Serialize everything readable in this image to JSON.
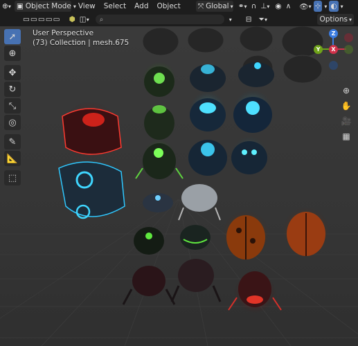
{
  "header": {
    "mode_label": "Object Mode",
    "menus": [
      "View",
      "Select",
      "Add",
      "Object"
    ],
    "orientation_label": "Global"
  },
  "header2": {
    "options_label": "Options"
  },
  "viewport": {
    "perspective_label": "User Perspective",
    "collection_label": "(73) Collection | mesh.675"
  },
  "gizmo": {
    "x_label": "X",
    "y_label": "Y",
    "z_label": "Z"
  },
  "colors": {
    "accent": "#4772b3",
    "axis_x": "#d0314a",
    "axis_y": "#6fa319",
    "axis_z": "#3a7be0"
  }
}
